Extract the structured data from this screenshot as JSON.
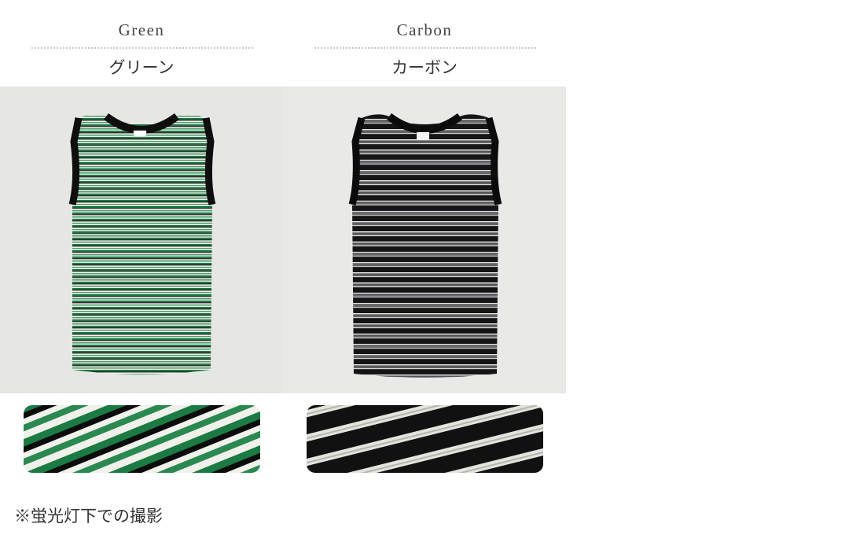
{
  "variants": [
    {
      "name_en": "Green",
      "name_ja": "グリーン",
      "photo_icon": "green-striped-tank-top-photo",
      "swatch_icon": "green-stripe-fabric-closeup",
      "colors": {
        "stripe": "#1f7a45",
        "base": "#f2f2ee",
        "trim": "#111111"
      }
    },
    {
      "name_en": "Carbon",
      "name_ja": "カーボン",
      "photo_icon": "carbon-striped-tank-top-photo",
      "swatch_icon": "carbon-stripe-fabric-closeup",
      "colors": {
        "stripe": "#dcdcdc",
        "base": "#141414",
        "trim": "#0c0c0c"
      }
    }
  ],
  "note": "※蛍光灯下での撮影"
}
